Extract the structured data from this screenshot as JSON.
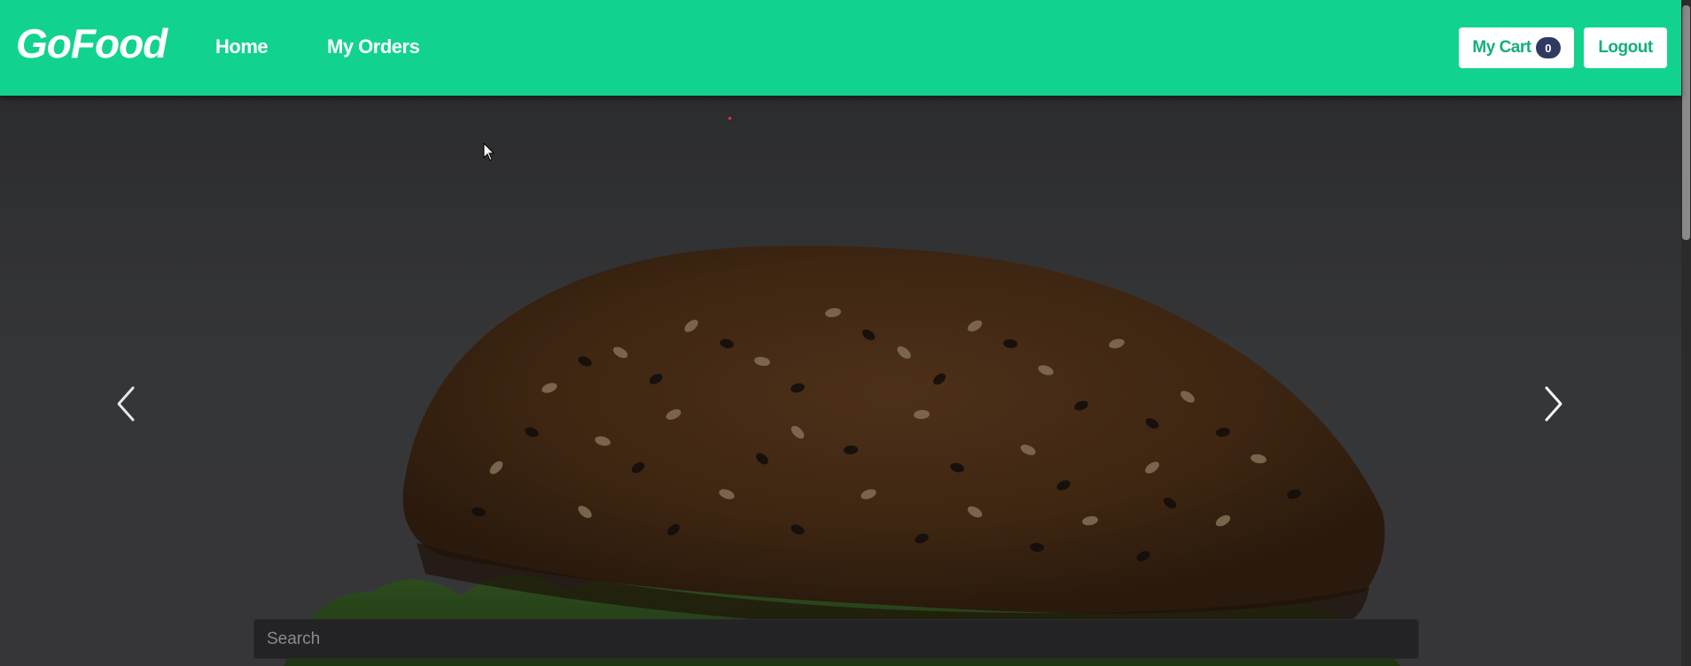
{
  "navbar": {
    "brand": "GoFood",
    "links": [
      {
        "label": "Home"
      },
      {
        "label": "My Orders"
      }
    ],
    "cart_button": {
      "label": "My Cart",
      "count": "0"
    },
    "logout_button": {
      "label": "Logout"
    }
  },
  "carousel": {
    "prev_icon": "chevron-left-icon",
    "next_icon": "chevron-right-icon",
    "slide_subject": "burger"
  },
  "search": {
    "placeholder": "Search",
    "value": ""
  },
  "colors": {
    "navbar": "#12d38d",
    "button_text": "#12b07a",
    "badge": "#2f3a63",
    "hero_overlay": "#4a4b4e",
    "search_bg": "#232326"
  }
}
